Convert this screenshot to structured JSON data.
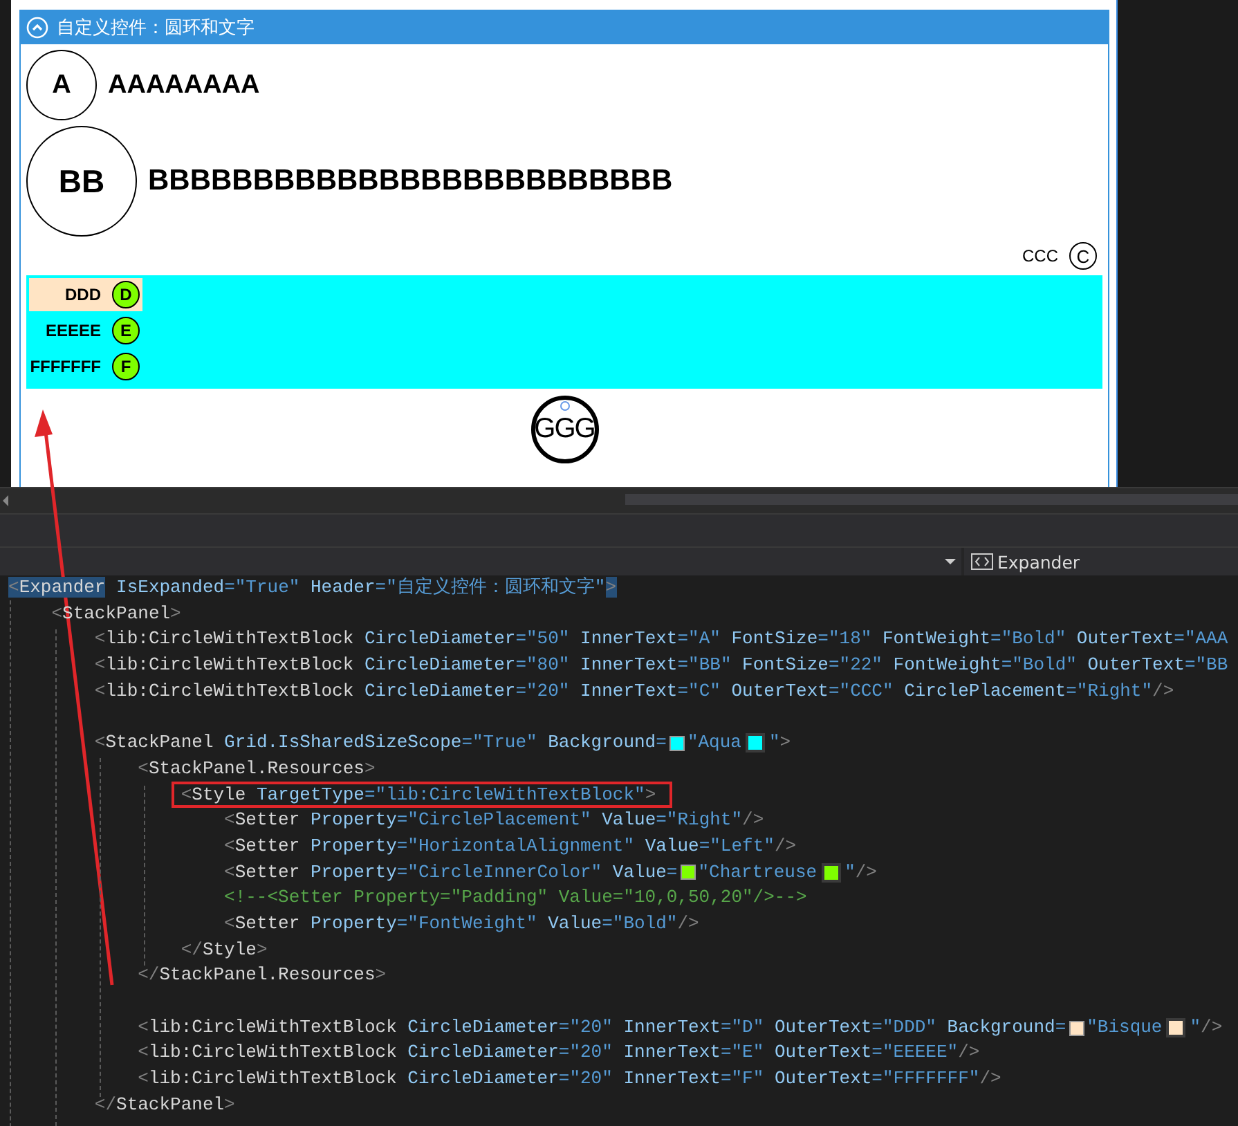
{
  "designer": {
    "expander": {
      "header": "自定义控件：圆环和文字",
      "expanded": true,
      "items": [
        {
          "kind": "medium",
          "inner": "A",
          "outer": "AAAAAAAA"
        },
        {
          "kind": "large",
          "inner": "BB",
          "outer": "BBBBBBBBBBBBBBBBBBBBBBBBB"
        },
        {
          "kind": "small-right",
          "inner": "C",
          "outer": "CCC"
        }
      ],
      "panel": {
        "color": "#00ffff",
        "items": [
          {
            "inner": "D",
            "outer": "DDD",
            "color": "#ffe4c4"
          },
          {
            "inner": "E",
            "outer": "EEEEE"
          },
          {
            "inner": "F",
            "outer": "FFFFFFF"
          }
        ]
      },
      "ring": {
        "text": "GGG"
      }
    }
  },
  "navigation": {
    "element": "Expander"
  },
  "code": {
    "lines": [
      {
        "kind": "code",
        "tokens": [
          {
            "kind": "punct-match",
            "text": "<"
          },
          {
            "kind": "tag-match",
            "text": "Expander"
          },
          {
            "kind": "attr",
            "text": " IsExpanded"
          },
          {
            "kind": "value",
            "text": "=\"True\""
          },
          {
            "kind": "attr",
            "text": " Header"
          },
          {
            "kind": "value",
            "text": "=\"自定义控件：圆环和文字\""
          },
          {
            "kind": "punct-match",
            "text": ">"
          }
        ]
      },
      {
        "kind": "code",
        "tokens": [
          {
            "kind": "punct",
            "text": "    <"
          },
          {
            "kind": "tag",
            "text": "StackPanel"
          },
          {
            "kind": "punct",
            "text": ">"
          }
        ]
      },
      {
        "kind": "code",
        "tokens": [
          {
            "kind": "punct",
            "text": "        <"
          },
          {
            "kind": "tag",
            "text": "lib:CircleWithTextBlock"
          },
          {
            "kind": "attr",
            "text": " CircleDiameter"
          },
          {
            "kind": "value",
            "text": "=\"50\""
          },
          {
            "kind": "attr",
            "text": " InnerText"
          },
          {
            "kind": "value",
            "text": "=\"A\""
          },
          {
            "kind": "attr",
            "text": " FontSize"
          },
          {
            "kind": "value",
            "text": "=\"18\""
          },
          {
            "kind": "attr",
            "text": " FontWeight"
          },
          {
            "kind": "value",
            "text": "=\"Bold\""
          },
          {
            "kind": "attr",
            "text": " OuterText"
          },
          {
            "kind": "value",
            "text": "=\"AAA"
          }
        ]
      },
      {
        "kind": "code",
        "tokens": [
          {
            "kind": "punct",
            "text": "        <"
          },
          {
            "kind": "tag",
            "text": "lib:CircleWithTextBlock"
          },
          {
            "kind": "attr",
            "text": " CircleDiameter"
          },
          {
            "kind": "value",
            "text": "=\"80\""
          },
          {
            "kind": "attr",
            "text": " InnerText"
          },
          {
            "kind": "value",
            "text": "=\"BB\""
          },
          {
            "kind": "attr",
            "text": " FontSize"
          },
          {
            "kind": "value",
            "text": "=\"22\""
          },
          {
            "kind": "attr",
            "text": " FontWeight"
          },
          {
            "kind": "value",
            "text": "=\"Bold\""
          },
          {
            "kind": "attr",
            "text": " OuterText"
          },
          {
            "kind": "value",
            "text": "=\"BB"
          }
        ]
      },
      {
        "kind": "code",
        "tokens": [
          {
            "kind": "punct",
            "text": "        <"
          },
          {
            "kind": "tag",
            "text": "lib:CircleWithTextBlock"
          },
          {
            "kind": "attr",
            "text": " CircleDiameter"
          },
          {
            "kind": "value",
            "text": "=\"20\""
          },
          {
            "kind": "attr",
            "text": " InnerText"
          },
          {
            "kind": "value",
            "text": "=\"C\""
          },
          {
            "kind": "attr",
            "text": " OuterText"
          },
          {
            "kind": "value",
            "text": "=\"CCC\""
          },
          {
            "kind": "attr",
            "text": " CirclePlacement"
          },
          {
            "kind": "value",
            "text": "=\"Right\""
          },
          {
            "kind": "punct",
            "text": "/>"
          }
        ]
      },
      {
        "kind": "blank"
      },
      {
        "kind": "code",
        "tokens": [
          {
            "kind": "punct",
            "text": "        <"
          },
          {
            "kind": "tag",
            "text": "StackPanel"
          },
          {
            "kind": "attr",
            "text": " Grid.IsSharedSizeScope"
          },
          {
            "kind": "value",
            "text": "=\"True\""
          },
          {
            "kind": "attr",
            "text": " Background"
          },
          {
            "kind": "value",
            "text": "="
          },
          {
            "kind": "swatch",
            "color": "#00ffff"
          },
          {
            "kind": "value",
            "text": "\"Aqua"
          },
          {
            "kind": "swatch-button",
            "color": "#00ffff"
          },
          {
            "kind": "value",
            "text": "\""
          },
          {
            "kind": "punct",
            "text": ">"
          }
        ]
      },
      {
        "kind": "code",
        "tokens": [
          {
            "kind": "punct",
            "text": "            <"
          },
          {
            "kind": "tag",
            "text": "StackPanel.Resources"
          },
          {
            "kind": "punct",
            "text": ">"
          }
        ]
      },
      {
        "kind": "code-boxed",
        "tokens": [
          {
            "kind": "punct",
            "text": "                <"
          },
          {
            "kind": "tag",
            "text": "Style"
          },
          {
            "kind": "attr",
            "text": " TargetType"
          },
          {
            "kind": "value",
            "text": "=\"lib:CircleWithTextBlock\""
          },
          {
            "kind": "punct",
            "text": ">"
          }
        ]
      },
      {
        "kind": "code",
        "tokens": [
          {
            "kind": "punct",
            "text": "                    <"
          },
          {
            "kind": "tag",
            "text": "Setter"
          },
          {
            "kind": "attr",
            "text": " Property"
          },
          {
            "kind": "value",
            "text": "=\"CirclePlacement\""
          },
          {
            "kind": "attr",
            "text": " Value"
          },
          {
            "kind": "value",
            "text": "=\"Right\""
          },
          {
            "kind": "punct",
            "text": "/>"
          }
        ]
      },
      {
        "kind": "code",
        "tokens": [
          {
            "kind": "punct",
            "text": "                    <"
          },
          {
            "kind": "tag",
            "text": "Setter"
          },
          {
            "kind": "attr",
            "text": " Property"
          },
          {
            "kind": "value",
            "text": "=\"HorizontalAlignment\""
          },
          {
            "kind": "attr",
            "text": " Value"
          },
          {
            "kind": "value",
            "text": "=\"Left\""
          },
          {
            "kind": "punct",
            "text": "/>"
          }
        ]
      },
      {
        "kind": "code",
        "tokens": [
          {
            "kind": "punct",
            "text": "                    <"
          },
          {
            "kind": "tag",
            "text": "Setter"
          },
          {
            "kind": "attr",
            "text": " Property"
          },
          {
            "kind": "value",
            "text": "=\"CircleInnerColor\""
          },
          {
            "kind": "attr",
            "text": " Value"
          },
          {
            "kind": "value",
            "text": "="
          },
          {
            "kind": "swatch",
            "color": "#7fff00"
          },
          {
            "kind": "value",
            "text": "\"Chartreuse"
          },
          {
            "kind": "swatch-button",
            "color": "#7fff00"
          },
          {
            "kind": "value",
            "text": "\""
          },
          {
            "kind": "punct",
            "text": "/>"
          }
        ]
      },
      {
        "kind": "code",
        "tokens": [
          {
            "kind": "comment",
            "text": "                    <!--<Setter Property=\"Padding\" Value=\"10,0,50,20\"/>-->"
          }
        ]
      },
      {
        "kind": "code",
        "tokens": [
          {
            "kind": "punct",
            "text": "                    <"
          },
          {
            "kind": "tag",
            "text": "Setter"
          },
          {
            "kind": "attr",
            "text": " Property"
          },
          {
            "kind": "value",
            "text": "=\"FontWeight\""
          },
          {
            "kind": "attr",
            "text": " Value"
          },
          {
            "kind": "value",
            "text": "=\"Bold\""
          },
          {
            "kind": "punct",
            "text": "/>"
          }
        ]
      },
      {
        "kind": "code",
        "tokens": [
          {
            "kind": "punct",
            "text": "                </"
          },
          {
            "kind": "tag",
            "text": "Style"
          },
          {
            "kind": "punct",
            "text": ">"
          }
        ]
      },
      {
        "kind": "code",
        "tokens": [
          {
            "kind": "punct",
            "text": "            </"
          },
          {
            "kind": "tag",
            "text": "StackPanel.Resources"
          },
          {
            "kind": "punct",
            "text": ">"
          }
        ]
      },
      {
        "kind": "blank"
      },
      {
        "kind": "code",
        "tokens": [
          {
            "kind": "punct",
            "text": "            <"
          },
          {
            "kind": "tag",
            "text": "lib:CircleWithTextBlock"
          },
          {
            "kind": "attr",
            "text": " CircleDiameter"
          },
          {
            "kind": "value",
            "text": "=\"20\""
          },
          {
            "kind": "attr",
            "text": " InnerText"
          },
          {
            "kind": "value",
            "text": "=\"D\""
          },
          {
            "kind": "attr",
            "text": " OuterText"
          },
          {
            "kind": "value",
            "text": "=\"DDD\""
          },
          {
            "kind": "attr",
            "text": " Background"
          },
          {
            "kind": "value",
            "text": "="
          },
          {
            "kind": "swatch",
            "color": "#ffe4c4"
          },
          {
            "kind": "value",
            "text": "\"Bisque"
          },
          {
            "kind": "swatch-button",
            "color": "#ffe4c4"
          },
          {
            "kind": "value",
            "text": "\""
          },
          {
            "kind": "punct",
            "text": "/>"
          }
        ]
      },
      {
        "kind": "code",
        "tokens": [
          {
            "kind": "punct",
            "text": "            <"
          },
          {
            "kind": "tag",
            "text": "lib:CircleWithTextBlock"
          },
          {
            "kind": "attr",
            "text": " CircleDiameter"
          },
          {
            "kind": "value",
            "text": "=\"20\""
          },
          {
            "kind": "attr",
            "text": " InnerText"
          },
          {
            "kind": "value",
            "text": "=\"E\""
          },
          {
            "kind": "attr",
            "text": " OuterText"
          },
          {
            "kind": "value",
            "text": "=\"EEEEE\""
          },
          {
            "kind": "punct",
            "text": "/>"
          }
        ]
      },
      {
        "kind": "code",
        "tokens": [
          {
            "kind": "punct",
            "text": "            <"
          },
          {
            "kind": "tag",
            "text": "lib:CircleWithTextBlock"
          },
          {
            "kind": "attr",
            "text": " CircleDiameter"
          },
          {
            "kind": "value",
            "text": "=\"20\""
          },
          {
            "kind": "attr",
            "text": " InnerText"
          },
          {
            "kind": "value",
            "text": "=\"F\""
          },
          {
            "kind": "attr",
            "text": " OuterText"
          },
          {
            "kind": "value",
            "text": "=\"FFFFFFF\""
          },
          {
            "kind": "punct",
            "text": "/>"
          }
        ]
      },
      {
        "kind": "code",
        "tokens": [
          {
            "kind": "punct",
            "text": "        </"
          },
          {
            "kind": "tag",
            "text": "StackPanel"
          },
          {
            "kind": "punct",
            "text": ">"
          }
        ]
      }
    ]
  }
}
